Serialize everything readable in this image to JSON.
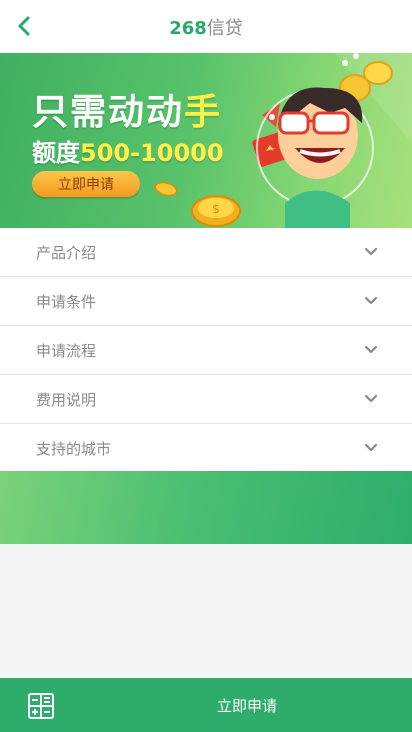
{
  "header": {
    "title_number": "268",
    "title_text": "信贷",
    "back_icon": "chevron-left-icon"
  },
  "banner": {
    "line1_main": "只需动动",
    "line1_highlight": "手",
    "line2_prefix": "额度",
    "line2_amount": "500-10000",
    "button_label": "立即申请",
    "coin_symbol": "$"
  },
  "accordion": {
    "items": [
      {
        "label": "产品介绍"
      },
      {
        "label": "申请条件"
      },
      {
        "label": "申请流程"
      },
      {
        "label": "费用说明"
      },
      {
        "label": "支持的城市"
      }
    ]
  },
  "footer": {
    "calculator_icon": "calculator-icon",
    "apply_label": "立即申请"
  },
  "colors": {
    "primary_green": "#2dac6b",
    "title_green": "#2aa86a",
    "banner_button": "#f29a22",
    "highlight_yellow": "#fff14a",
    "text_gray": "#8a8a8a"
  }
}
